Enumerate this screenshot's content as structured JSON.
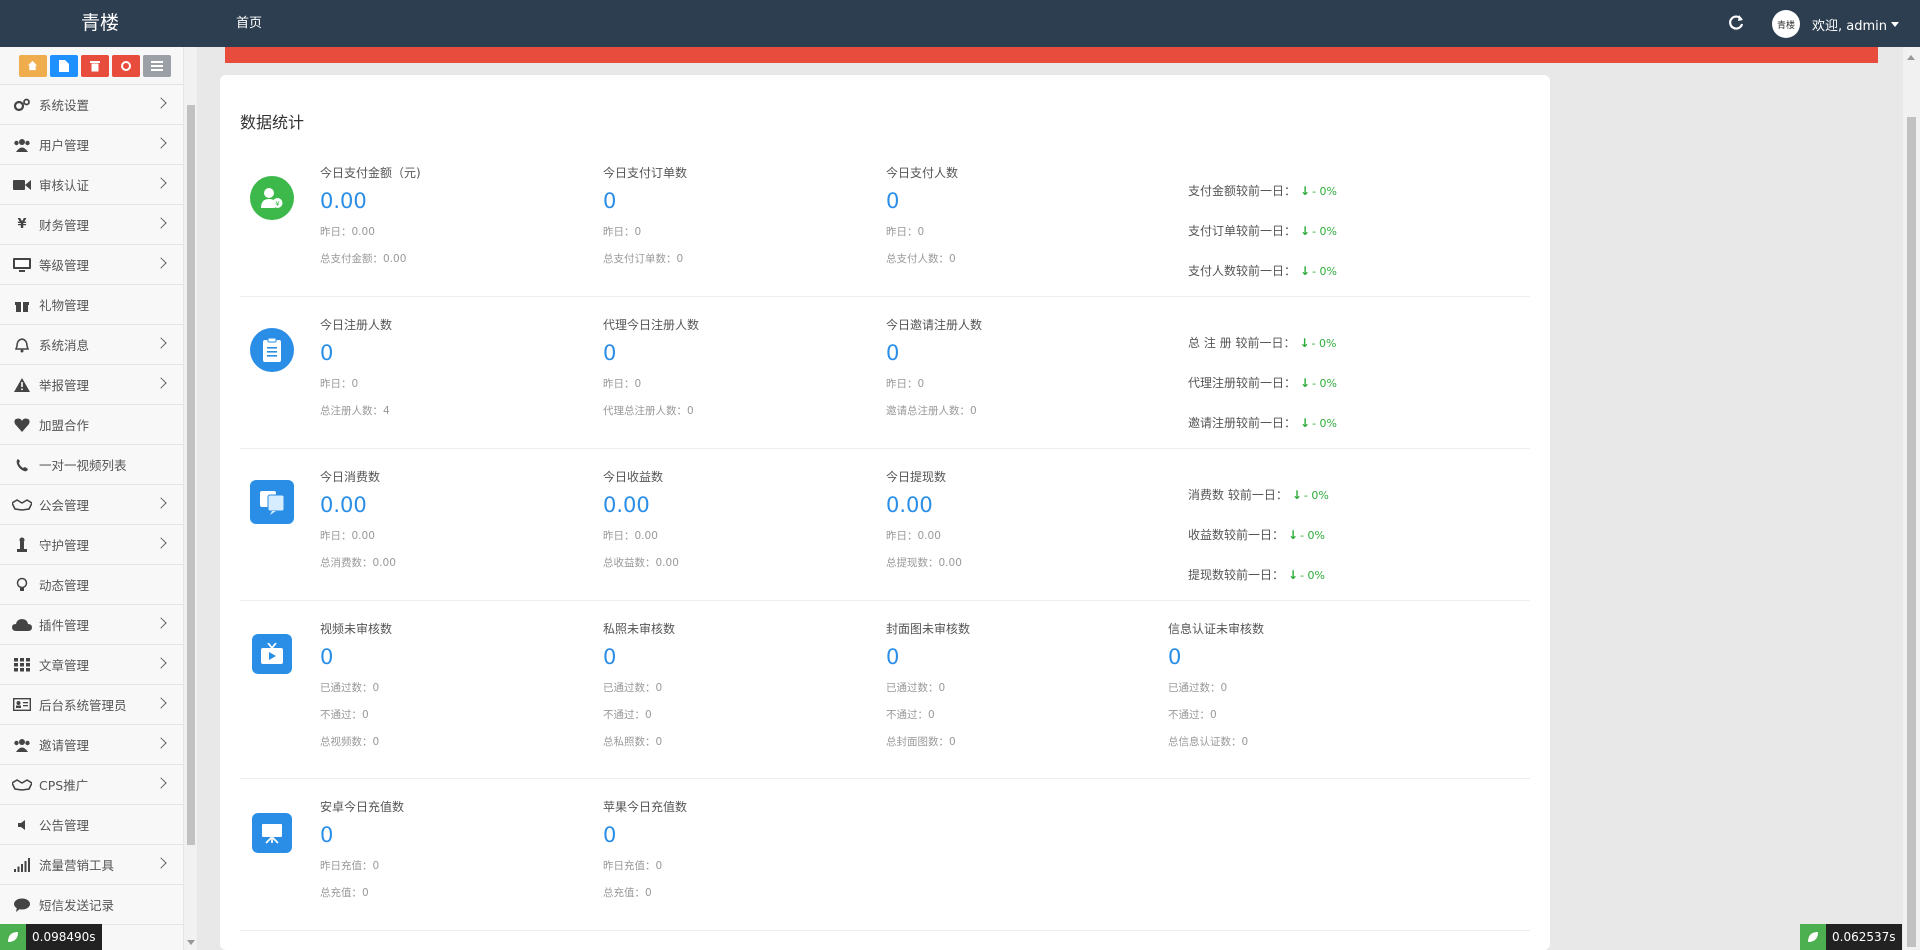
{
  "app": {
    "brand": "青楼",
    "nav_home": "首页"
  },
  "header": {
    "avatar_text": "青楼",
    "welcome": "欢迎, admin"
  },
  "colors": {
    "topbar": "#2d3e50",
    "accent_blue": "#2a8ee6",
    "alert_red": "#e74c3c",
    "up_down_green": "#2eac3a"
  },
  "shortcuts": [
    {
      "icon": "home-icon",
      "color": "#f0ad4e"
    },
    {
      "icon": "file-icon",
      "color": "#1e90ff"
    },
    {
      "icon": "trash-icon",
      "color": "#e74c3c"
    },
    {
      "icon": "recycle-icon",
      "color": "#e74c3c"
    },
    {
      "icon": "list-icon",
      "color": "#9aa0a6"
    }
  ],
  "sidebar": {
    "items": [
      {
        "label": "系统设置",
        "icon": "gears-icon",
        "arrow": true
      },
      {
        "label": "用户管理",
        "icon": "users-icon",
        "arrow": true
      },
      {
        "label": "审核认证",
        "icon": "video-camera-icon",
        "arrow": true
      },
      {
        "label": "财务管理",
        "icon": "yen-icon",
        "arrow": true
      },
      {
        "label": "等级管理",
        "icon": "monitor-icon",
        "arrow": true
      },
      {
        "label": "礼物管理",
        "icon": "gift-icon",
        "arrow": false
      },
      {
        "label": "系统消息",
        "icon": "bell-icon",
        "arrow": true
      },
      {
        "label": "举报管理",
        "icon": "warning-icon",
        "arrow": true
      },
      {
        "label": "加盟合作",
        "icon": "heart-icon",
        "arrow": false
      },
      {
        "label": "一对一视频列表",
        "icon": "phone-icon",
        "arrow": false
      },
      {
        "label": "公会管理",
        "icon": "handshake-icon",
        "arrow": true
      },
      {
        "label": "守护管理",
        "icon": "chess-piece-icon",
        "arrow": true
      },
      {
        "label": "动态管理",
        "icon": "lightbulb-icon",
        "arrow": false
      },
      {
        "label": "插件管理",
        "icon": "cloud-icon",
        "arrow": true
      },
      {
        "label": "文章管理",
        "icon": "grid-icon",
        "arrow": true
      },
      {
        "label": "后台系统管理员",
        "icon": "id-card-icon",
        "arrow": true
      },
      {
        "label": "邀请管理",
        "icon": "users-icon",
        "arrow": true
      },
      {
        "label": "CPS推广",
        "icon": "handshake-icon",
        "arrow": true
      },
      {
        "label": "公告管理",
        "icon": "volume-icon",
        "arrow": false
      },
      {
        "label": "流量营销工具",
        "icon": "signal-icon",
        "arrow": true
      },
      {
        "label": "短信发送记录",
        "icon": "comment-icon",
        "arrow": false
      }
    ]
  },
  "main": {
    "title": "数据统计",
    "rows": [
      {
        "icon": "user-money-icon",
        "cols": [
          {
            "label": "今日支付金额（元)",
            "value": "0.00",
            "subs": [
              "昨日：0.00",
              "总支付金额：0.00"
            ]
          },
          {
            "label": "今日支付订单数",
            "value": "0",
            "subs": [
              "昨日：0",
              "总支付订单数：0"
            ]
          },
          {
            "label": "今日支付人数",
            "value": "0",
            "subs": [
              "昨日：0",
              "总支付人数：0"
            ]
          }
        ],
        "compare": [
          {
            "label": "支付金额较前一日：",
            "value": "- 0%"
          },
          {
            "label": "支付订单较前一日：",
            "value": "- 0%"
          },
          {
            "label": "支付人数较前一日：",
            "value": "- 0%"
          }
        ]
      },
      {
        "icon": "clipboard-icon",
        "cols": [
          {
            "label": "今日注册人数",
            "value": "0",
            "subs": [
              "昨日：0",
              "总注册人数：4"
            ]
          },
          {
            "label": "代理今日注册人数",
            "value": "0",
            "subs": [
              "昨日：0",
              "代理总注册人数：0"
            ]
          },
          {
            "label": "今日邀请注册人数",
            "value": "0",
            "subs": [
              "昨日：0",
              "邀请总注册人数：0"
            ]
          }
        ],
        "compare": [
          {
            "label": "总 注 册 较前一日：",
            "value": "- 0%"
          },
          {
            "label": "代理注册较前一日：",
            "value": "- 0%"
          },
          {
            "label": "邀请注册较前一日：",
            "value": "- 0%"
          }
        ]
      },
      {
        "icon": "chat-bubbles-icon",
        "cols": [
          {
            "label": "今日消费数",
            "value": "0.00",
            "subs": [
              "昨日：0.00",
              "总消费数：0.00"
            ]
          },
          {
            "label": "今日收益数",
            "value": "0.00",
            "subs": [
              "昨日：0.00",
              "总收益数：0.00"
            ]
          },
          {
            "label": "今日提现数",
            "value": "0.00",
            "subs": [
              "昨日：0.00",
              "总提现数：0.00"
            ]
          }
        ],
        "compare": [
          {
            "label": "消费数 较前一日：",
            "value": "- 0%"
          },
          {
            "label": "收益数较前一日：",
            "value": "- 0%"
          },
          {
            "label": "提现数较前一日：",
            "value": "- 0%"
          }
        ]
      },
      {
        "icon": "tv-play-icon",
        "cols": [
          {
            "label": "视频未审核数",
            "value": "0",
            "subs": [
              "已通过数：0",
              "不通过：0",
              "总视频数：0"
            ]
          },
          {
            "label": "私照未审核数",
            "value": "0",
            "subs": [
              "已通过数：0",
              "不通过：0",
              "总私照数：0"
            ]
          },
          {
            "label": "封面图未审核数",
            "value": "0",
            "subs": [
              "已通过数：0",
              "不通过：0",
              "总封面图数：0"
            ]
          },
          {
            "label": "信息认证未审核数",
            "value": "0",
            "subs": [
              "已通过数：0",
              "不通过：0",
              "总信息认证数：0"
            ]
          }
        ]
      },
      {
        "icon": "presentation-icon",
        "cols": [
          {
            "label": "安卓今日充值数",
            "value": "0",
            "subs": [
              "昨日充值：0",
              "总充值：0"
            ]
          },
          {
            "label": "苹果今日充值数",
            "value": "0",
            "subs": [
              "昨日充值：0",
              "总充值：0"
            ]
          }
        ]
      }
    ]
  },
  "debug": {
    "left_timer": "0.098490s",
    "right_timer": "0.062537s"
  }
}
